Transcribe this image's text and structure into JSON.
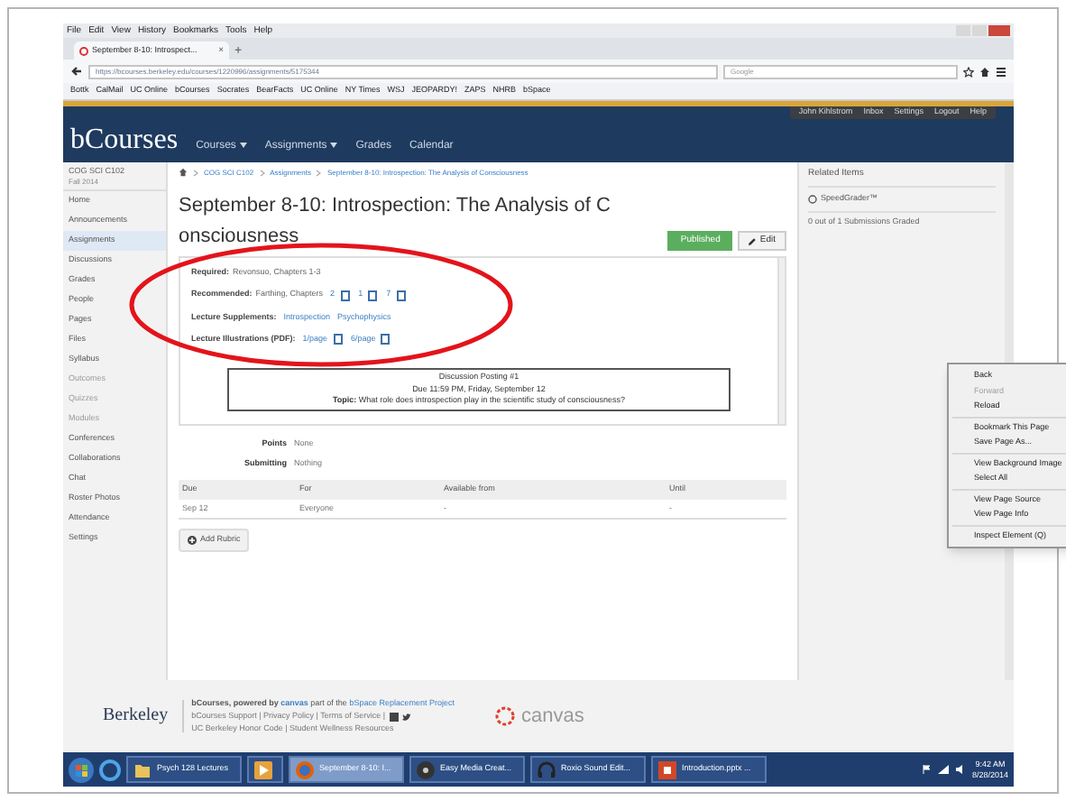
{
  "browser": {
    "menu": [
      "File",
      "Edit",
      "View",
      "History",
      "Bookmarks",
      "Tools",
      "Help"
    ],
    "tab": {
      "title": "September 8-10: Introspect...",
      "close": "×"
    },
    "new_tab": "+",
    "url": "https://bcourses.berkeley.edu/courses/1220996/assignments/5175344",
    "search_placeholder": "Google",
    "bookmarks": [
      "Bottk",
      "CalMail",
      "UC Online",
      "bCourses",
      "Socrates",
      "BearFacts",
      "UC Online",
      "NY Times",
      "WSJ",
      "JEOPARDY!",
      "ZAPS",
      "NHRB",
      "bSpace"
    ]
  },
  "header": {
    "logo": "bCourses",
    "nav": [
      {
        "label": "Courses",
        "dropdown": true
      },
      {
        "label": "Assignments",
        "dropdown": true
      },
      {
        "label": "Grades",
        "dropdown": false
      },
      {
        "label": "Calendar",
        "dropdown": false
      }
    ],
    "user_links": [
      "John Kihlstrom",
      "Inbox",
      "Settings",
      "Logout",
      "Help"
    ]
  },
  "sidebar": {
    "course": "COG SCI C102",
    "term": "Fall 2014",
    "items": [
      {
        "label": "Home",
        "selected": false,
        "disabled": false
      },
      {
        "label": "Announcements",
        "selected": false,
        "disabled": false
      },
      {
        "label": "Assignments",
        "selected": true,
        "disabled": false
      },
      {
        "label": "Discussions",
        "selected": false,
        "disabled": false
      },
      {
        "label": "Grades",
        "selected": false,
        "disabled": false
      },
      {
        "label": "People",
        "selected": false,
        "disabled": false
      },
      {
        "label": "Pages",
        "selected": false,
        "disabled": false
      },
      {
        "label": "Files",
        "selected": false,
        "disabled": false
      },
      {
        "label": "Syllabus",
        "selected": false,
        "disabled": false
      },
      {
        "label": "Outcomes",
        "selected": false,
        "disabled": true
      },
      {
        "label": "Quizzes",
        "selected": false,
        "disabled": true
      },
      {
        "label": "Modules",
        "selected": false,
        "disabled": true
      },
      {
        "label": "Conferences",
        "selected": false,
        "disabled": false
      },
      {
        "label": "Collaborations",
        "selected": false,
        "disabled": false
      },
      {
        "label": "Chat",
        "selected": false,
        "disabled": false
      },
      {
        "label": "Roster Photos",
        "selected": false,
        "disabled": false
      },
      {
        "label": "Attendance",
        "selected": false,
        "disabled": false
      },
      {
        "label": "Settings",
        "selected": false,
        "disabled": false
      }
    ]
  },
  "breadcrumb": [
    "COG SCI C102",
    "Assignments",
    "September 8-10: Introspection: The Analysis of Consciousness"
  ],
  "title_lines": [
    "September 8-10: Introspection: The Analysis of C",
    "onsciousness"
  ],
  "buttons": {
    "published": "Published",
    "edit": "Edit"
  },
  "description": [
    {
      "label": "Required:",
      "text": "Revonsuo, Chapters 1-3"
    },
    {
      "label": "Recommended:",
      "text": "Farthing, Chapters",
      "links": [
        "2",
        "1",
        "7"
      ]
    },
    {
      "label": "Lecture Supplements:",
      "links": [
        "Introspection",
        "Psychophysics"
      ]
    },
    {
      "label": "Lecture Illustrations (PDF):",
      "links": [
        "1/page",
        "6/page"
      ]
    }
  ],
  "discussion": {
    "title": "Discussion Posting #1",
    "due": "Due 11:59 PM, Friday, September 12",
    "topic_label": "Topic:",
    "topic": "What role does introspection play in the scientific study of consciousness?"
  },
  "details": [
    {
      "label": "Points",
      "value": "None"
    },
    {
      "label": "Submitting",
      "value": "Nothing"
    }
  ],
  "table": {
    "columns": [
      "Due",
      "For",
      "Available from",
      "Until"
    ],
    "rows": [
      [
        "Sep 12",
        "Everyone",
        "-",
        "-"
      ]
    ]
  },
  "add_rubric": "Add Rubric",
  "related": {
    "title": "Related Items",
    "speedgrader": "SpeedGrader™",
    "graded": "0 out of 1 Submissions Graded"
  },
  "context_menu": [
    {
      "kind": "item",
      "label": "Back",
      "disabled": false
    },
    {
      "kind": "item",
      "label": "Forward",
      "disabled": true
    },
    {
      "kind": "item",
      "label": "Reload",
      "disabled": false
    },
    {
      "kind": "separator"
    },
    {
      "kind": "item",
      "label": "Bookmark This Page",
      "disabled": false
    },
    {
      "kind": "item",
      "label": "Save Page As...",
      "disabled": false
    },
    {
      "kind": "separator"
    },
    {
      "kind": "item",
      "label": "View Background Image",
      "disabled": false
    },
    {
      "kind": "item",
      "label": "Select All",
      "disabled": false
    },
    {
      "kind": "separator"
    },
    {
      "kind": "item",
      "label": "View Page Source",
      "disabled": false
    },
    {
      "kind": "item",
      "label": "View Page Info",
      "disabled": false
    },
    {
      "kind": "separator"
    },
    {
      "kind": "item",
      "label": "Inspect Element (Q)",
      "disabled": false
    }
  ],
  "footer": {
    "berkeley": "Berkeley",
    "powered": "bCourses, powered by",
    "canvas_link": "canvas",
    "part_of": "part of the",
    "project": "bSpace Replacement Project",
    "links_1": "bCourses Support | Privacy Policy | Terms of Service |",
    "links_2": "UC Berkeley Honor Code | Student Wellness Resources",
    "canvas_logo": "canvas"
  },
  "taskbar": {
    "items": [
      {
        "kind": "folder",
        "label": "Psych 128 Lectures",
        "selected": false
      },
      {
        "kind": "media",
        "selected": false
      },
      {
        "kind": "firefox",
        "label": "September 8-10: I...",
        "selected": true
      },
      {
        "kind": "disc",
        "label": "Easy Media Creat...",
        "selected": false
      },
      {
        "kind": "headphones",
        "label": "Roxio Sound Edit...",
        "selected": false
      },
      {
        "kind": "powerpoint",
        "label": "Introduction.pptx ...",
        "selected": false
      }
    ],
    "time": "9:42 AM",
    "date": "8/28/2014"
  }
}
